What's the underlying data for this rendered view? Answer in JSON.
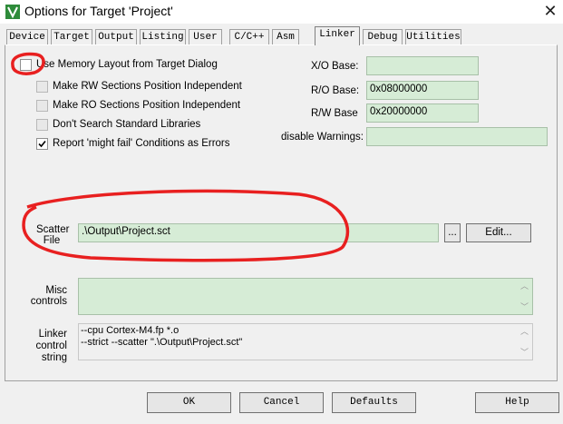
{
  "window": {
    "title": "Options for Target 'Project'"
  },
  "tabs": [
    "Device",
    "Target",
    "Output",
    "Listing",
    "User",
    "C/C++",
    "Asm",
    "Linker",
    "Debug",
    "Utilities"
  ],
  "options": {
    "use_memory_layout": "Use Memory Layout from Target Dialog",
    "make_rw": "Make RW Sections Position Independent",
    "make_ro": "Make RO Sections Position Independent",
    "dont_search": "Don't Search Standard Libraries",
    "report_might_fail": "Report 'might fail' Conditions as Errors"
  },
  "addresses": {
    "xo_label": "X/O Base:",
    "xo_value": "",
    "ro_label": "R/O Base:",
    "ro_value": "0x08000000",
    "rw_label": "R/W Base",
    "rw_value": "0x20000000",
    "disable_label": "disable Warnings:",
    "disable_value": ""
  },
  "scatter": {
    "label_line1": "Scatter",
    "label_line2": "File",
    "value": ".\\Output\\Project.sct",
    "browse_label": "...",
    "edit_label": "Edit..."
  },
  "misc": {
    "label_line1": "Misc",
    "label_line2": "controls"
  },
  "linker_control": {
    "label_line1": "Linker",
    "label_line2": "control",
    "label_line3": "string",
    "line1": "--cpu Cortex-M4.fp *.o",
    "line2": "--strict --scatter \".\\Output\\Project.sct\""
  },
  "buttons": {
    "ok": "OK",
    "cancel": "Cancel",
    "defaults": "Defaults",
    "help": "Help"
  },
  "icons": {
    "app": "keil-uvision-icon",
    "close": "close-icon",
    "check": "checkmark-icon",
    "scroll_up": "scroll-up-icon",
    "scroll_down": "scroll-down-icon"
  },
  "colors": {
    "field_bg": "#d6ecd6",
    "annotation": "#e82020"
  }
}
